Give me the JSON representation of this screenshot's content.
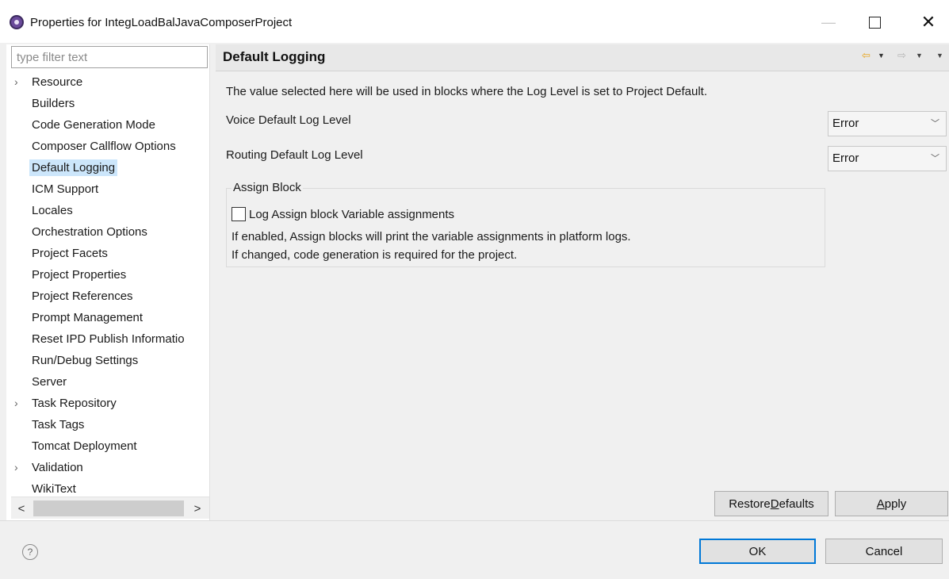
{
  "window": {
    "title": "Properties for IntegLoadBalJavaComposerProject",
    "minimize": "—",
    "close": "✕"
  },
  "sidebar": {
    "filter_placeholder": "type filter text",
    "items": [
      {
        "label": "Resource",
        "expandable": true
      },
      {
        "label": "Builders"
      },
      {
        "label": "Code Generation Mode"
      },
      {
        "label": "Composer Callflow Options"
      },
      {
        "label": "Default Logging",
        "selected": true
      },
      {
        "label": "ICM Support"
      },
      {
        "label": "Locales"
      },
      {
        "label": "Orchestration Options"
      },
      {
        "label": "Project Facets"
      },
      {
        "label": "Project Properties"
      },
      {
        "label": "Project References"
      },
      {
        "label": "Prompt Management"
      },
      {
        "label": "Reset IPD Publish Informatio"
      },
      {
        "label": "Run/Debug Settings"
      },
      {
        "label": "Server"
      },
      {
        "label": "Task Repository",
        "expandable": true
      },
      {
        "label": "Task Tags"
      },
      {
        "label": "Tomcat Deployment"
      },
      {
        "label": "Validation",
        "expandable": true
      },
      {
        "label": "WikiText"
      }
    ],
    "scroll_left": "<",
    "scroll_right": ">"
  },
  "page": {
    "title": "Default Logging",
    "description": "The value selected here will be used in blocks where the Log Level is set to Project Default.",
    "voice_label": "Voice Default Log Level",
    "voice_value": "Error",
    "routing_label": "Routing Default Log Level",
    "routing_value": "Error",
    "group_title": "Assign Block",
    "checkbox_label": "Log Assign block Variable assignments",
    "checkbox_checked": false,
    "info_line1": "If enabled, Assign blocks will print the variable assignments in platform logs.",
    "info_line2": "If changed, code generation is required for the project."
  },
  "buttons": {
    "restore_pre": "Restore ",
    "restore_mnemonic": "D",
    "restore_post": "efaults",
    "apply_mnemonic": "A",
    "apply_post": "pply",
    "ok": "OK",
    "cancel": "Cancel"
  },
  "help_glyph": "?",
  "colors": {
    "selection": "#cce6fb",
    "default_button_border": "#0078d7",
    "nav_back": "#e8a317"
  }
}
